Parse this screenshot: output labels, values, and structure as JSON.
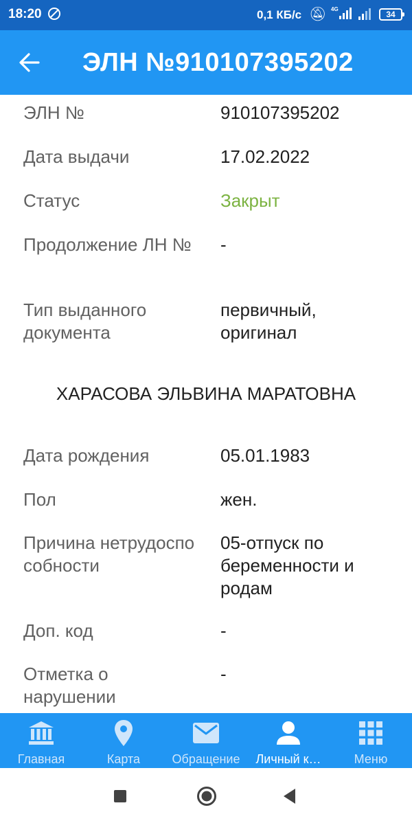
{
  "statusbar": {
    "time": "18:20",
    "speed": "0,1 КБ/с",
    "battery": "34"
  },
  "appbar": {
    "title": "ЭЛН №910107395202"
  },
  "details": [
    {
      "label": "ЭЛН №",
      "value": "910107395202",
      "status_color": ""
    },
    {
      "label": "Дата выдачи",
      "value": "17.02.2022",
      "status_color": ""
    },
    {
      "label": "Статус",
      "value": "Закрыт",
      "status_color": "#7cb342"
    },
    {
      "label": "Продолжение ЛН №",
      "value": "-",
      "status_color": ""
    },
    {
      "label": "Тип выданного документа",
      "value": "первичный, оригинал",
      "status_color": ""
    }
  ],
  "person": {
    "name": "ХАРАСОВА ЭЛЬВИНА МАРАТОВНА"
  },
  "person_details": [
    {
      "label": "Дата рождения",
      "value": "05.01.1983"
    },
    {
      "label": "Пол",
      "value": "жен."
    },
    {
      "label": "Причина нетрудоспособности",
      "value": "05-отпуск по беременности и родам"
    },
    {
      "label": "Доп. код",
      "value": "-"
    },
    {
      "label": "Отметка о нарушении режима",
      "value": "-"
    }
  ],
  "bottom_nav": [
    {
      "label": "Главная",
      "icon": "bank-icon",
      "active": false
    },
    {
      "label": "Карта",
      "icon": "map-pin-icon",
      "active": false
    },
    {
      "label": "Обращение",
      "icon": "envelope-icon",
      "active": false
    },
    {
      "label": "Личный к…",
      "icon": "person-icon",
      "active": true
    },
    {
      "label": "Меню",
      "icon": "grid-icon",
      "active": false
    }
  ],
  "colors": {
    "statusbar": "#1565c0",
    "appbar": "#2196f3",
    "accent_green": "#7cb342"
  }
}
